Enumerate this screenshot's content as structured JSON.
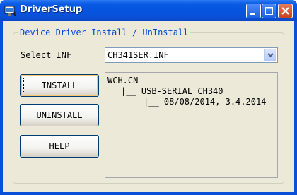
{
  "window": {
    "title": "DriverSetup",
    "icon": "driver-setup-app-icon",
    "controls": {
      "minimize": "minimize-icon",
      "maximize": "maximize-icon",
      "close": "close-icon"
    }
  },
  "group": {
    "title": "Device Driver Install / UnInstall"
  },
  "inf_select": {
    "label": "Select INF",
    "value": "CH341SER.INF"
  },
  "buttons": {
    "install": "INSTALL",
    "uninstall": "UNINSTALL",
    "help": "HELP"
  },
  "info": {
    "lines": [
      "WCH.CN",
      "|__ USB-SERIAL CH340",
      "|__ 08/08/2014, 3.4.2014"
    ]
  },
  "colors": {
    "titlebar": "#0454e0",
    "group_title": "#0046d5",
    "client_bg": "#ece9d8"
  }
}
